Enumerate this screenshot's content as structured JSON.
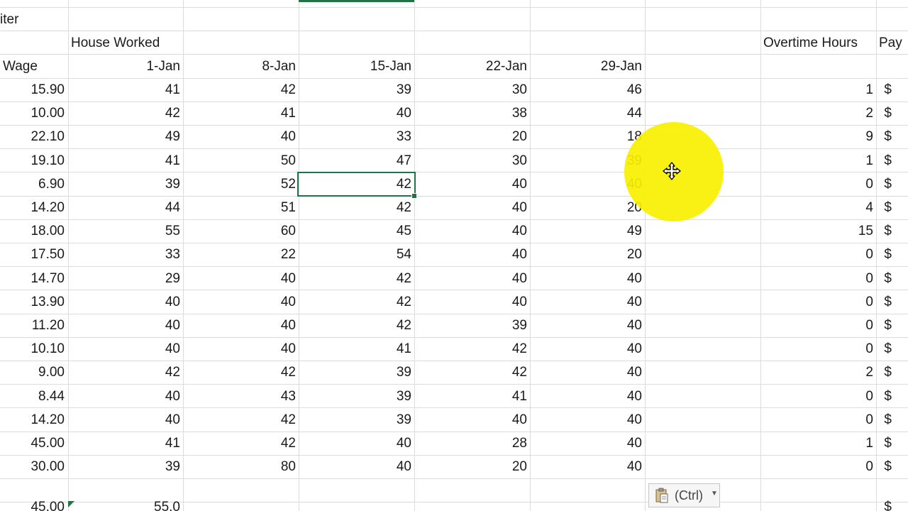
{
  "sheet": {
    "title_fragment": "iter",
    "group_header": "House Worked",
    "overtime_header": "Overtime Hours",
    "pay_header": "Pay",
    "wage_header": "Wage",
    "week_headers": [
      "1-Jan",
      "8-Jan",
      "15-Jan",
      "22-Jan",
      "29-Jan"
    ],
    "rows": [
      {
        "wage": "15.90",
        "hours": [
          "41",
          "42",
          "39",
          "30",
          "46"
        ],
        "overtime": "1",
        "pay": "$"
      },
      {
        "wage": "10.00",
        "hours": [
          "42",
          "41",
          "40",
          "38",
          "44"
        ],
        "overtime": "2",
        "pay": "$"
      },
      {
        "wage": "22.10",
        "hours": [
          "49",
          "40",
          "33",
          "20",
          "18"
        ],
        "overtime": "9",
        "pay": "$"
      },
      {
        "wage": "19.10",
        "hours": [
          "41",
          "50",
          "47",
          "30",
          "39"
        ],
        "overtime": "1",
        "pay": "$"
      },
      {
        "wage": "6.90",
        "hours": [
          "39",
          "52",
          "42",
          "40",
          "40"
        ],
        "overtime": "0",
        "pay": "$"
      },
      {
        "wage": "14.20",
        "hours": [
          "44",
          "51",
          "42",
          "40",
          "20"
        ],
        "overtime": "4",
        "pay": "$"
      },
      {
        "wage": "18.00",
        "hours": [
          "55",
          "60",
          "45",
          "40",
          "49"
        ],
        "overtime": "15",
        "pay": "$"
      },
      {
        "wage": "17.50",
        "hours": [
          "33",
          "22",
          "54",
          "40",
          "20"
        ],
        "overtime": "0",
        "pay": "$"
      },
      {
        "wage": "14.70",
        "hours": [
          "29",
          "40",
          "42",
          "40",
          "40"
        ],
        "overtime": "0",
        "pay": "$"
      },
      {
        "wage": "13.90",
        "hours": [
          "40",
          "40",
          "42",
          "40",
          "40"
        ],
        "overtime": "0",
        "pay": "$"
      },
      {
        "wage": "11.20",
        "hours": [
          "40",
          "40",
          "42",
          "39",
          "40"
        ],
        "overtime": "0",
        "pay": "$"
      },
      {
        "wage": "10.10",
        "hours": [
          "40",
          "40",
          "41",
          "42",
          "40"
        ],
        "overtime": "0",
        "pay": "$"
      },
      {
        "wage": "9.00",
        "hours": [
          "42",
          "42",
          "39",
          "42",
          "40"
        ],
        "overtime": "2",
        "pay": "$"
      },
      {
        "wage": "8.44",
        "hours": [
          "40",
          "43",
          "39",
          "41",
          "40"
        ],
        "overtime": "0",
        "pay": "$"
      },
      {
        "wage": "14.20",
        "hours": [
          "40",
          "42",
          "39",
          "40",
          "40"
        ],
        "overtime": "0",
        "pay": "$"
      },
      {
        "wage": "45.00",
        "hours": [
          "41",
          "42",
          "40",
          "28",
          "40"
        ],
        "overtime": "1",
        "pay": "$"
      },
      {
        "wage": "30.00",
        "hours": [
          "39",
          "80",
          "40",
          "20",
          "40"
        ],
        "overtime": "0",
        "pay": "$"
      }
    ],
    "partial_row": {
      "wage": "45.00",
      "hours_first": "55.0",
      "pay": "$"
    },
    "selected_cell_value": "42"
  },
  "paste_options": {
    "label": "(Ctrl)",
    "icon": "clipboard-icon",
    "caret_icon": "chevron-down-icon"
  },
  "cursor": {
    "icon": "move-cursor-icon"
  },
  "colors": {
    "grid": "#dcdcdc",
    "selection": "#217346",
    "highlight": "#f8ef00"
  }
}
